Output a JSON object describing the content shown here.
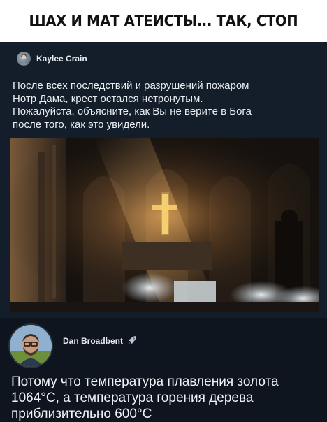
{
  "header": {
    "title": "ШАХ И МАТ АТЕИСТЫ... ТАК, СТОП"
  },
  "tweet": {
    "author_name": "Kaylee Crain",
    "author_avatar_icon": "user-avatar-icon",
    "text_lines": [
      "После всех последствий и разрушений пожаром",
      "Нотр Дама, крест остался нетронутым.",
      "Пожалуйста, объясните, как Вы не верите в Бога",
      "после того, как это увидели."
    ],
    "photo_icon": "cathedral-cross-photo"
  },
  "reply": {
    "author_name": "Dan Broadbent",
    "badge_icon": "rocket-icon",
    "avatar_icon": "user-avatar-icon",
    "text_lines": [
      "Потому что температура плавления золота",
      "1064°C, а температура горения дерева",
      "приблизительно 600°C"
    ]
  },
  "colors": {
    "card_bg": "#141d2a",
    "reply_bg": "#0e151f",
    "text": "#e9edf1",
    "header_bg": "#ffffff",
    "header_text": "#111111"
  }
}
